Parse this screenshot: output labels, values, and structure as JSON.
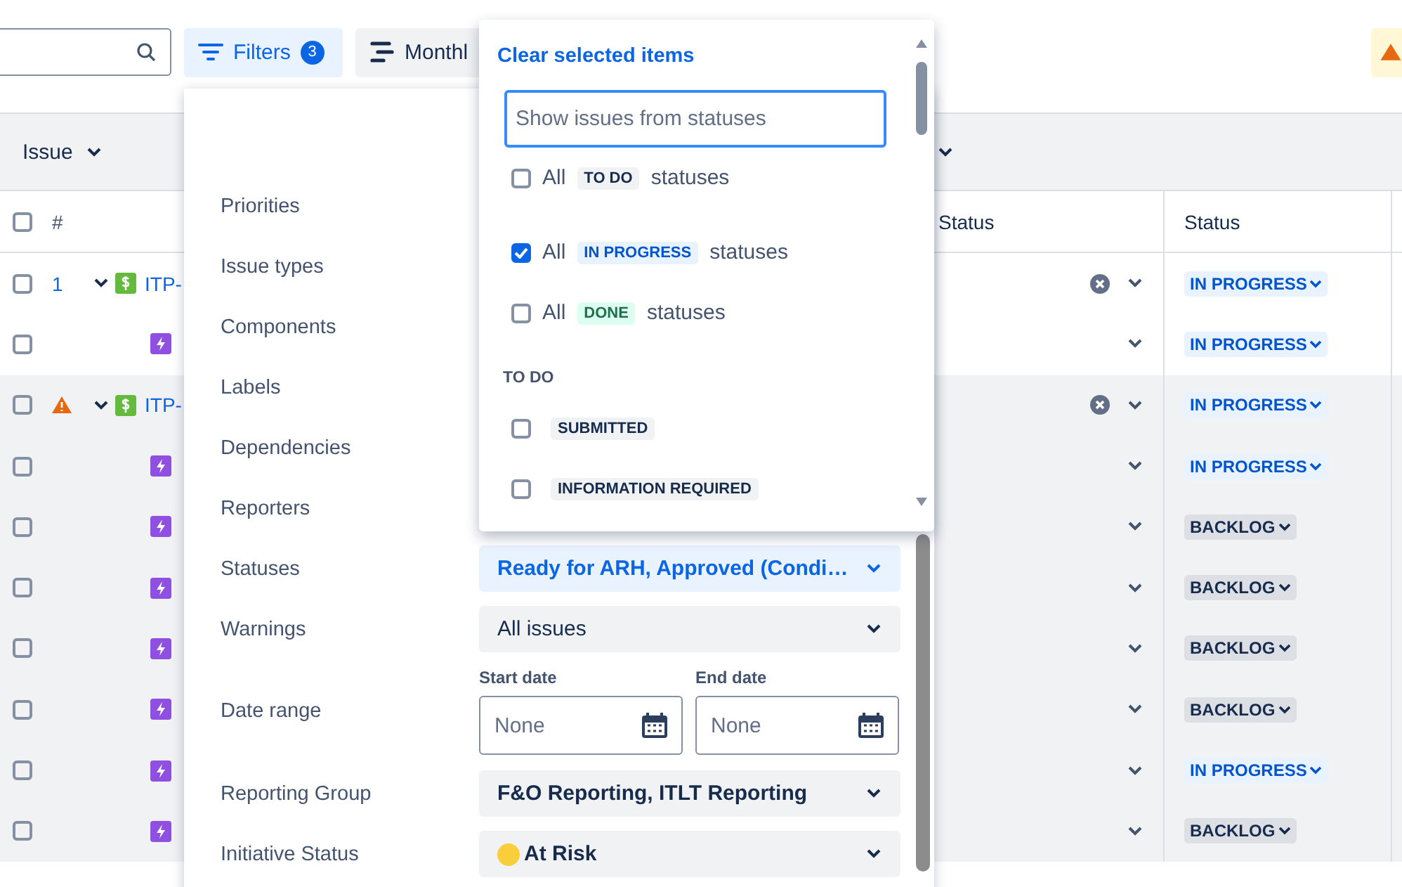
{
  "toolbar": {
    "filters": {
      "label": "Filters",
      "count": "3",
      "active": true
    },
    "view": {
      "label": "Monthl"
    }
  },
  "table": {
    "group_header": {
      "label": "Issue"
    },
    "select_all": {
      "checked": false
    },
    "columns": [
      {
        "label": "#"
      },
      {
        "label": "Status"
      },
      {
        "label": "Status"
      }
    ],
    "rows": [
      {
        "checked": false,
        "number": "1",
        "expanded": true,
        "key": "ITP-",
        "clearable": true,
        "status": {
          "label": "IN PROGRESS",
          "kind": "progress"
        },
        "highlighted": false,
        "children": [
          {
            "checked": false,
            "status": {
              "label": "IN PROGRESS",
              "kind": "progress"
            }
          }
        ]
      },
      {
        "checked": false,
        "warning": true,
        "expanded": true,
        "key": "ITP-",
        "clearable": true,
        "status": {
          "label": "IN PROGRESS",
          "kind": "progress"
        },
        "highlighted": true,
        "children": [
          {
            "checked": false,
            "status": {
              "label": "IN PROGRESS",
              "kind": "progress"
            }
          },
          {
            "checked": false,
            "status": {
              "label": "BACKLOG",
              "kind": "todo"
            }
          },
          {
            "checked": false,
            "status": {
              "label": "BACKLOG",
              "kind": "todo"
            }
          },
          {
            "checked": false,
            "status": {
              "label": "BACKLOG",
              "kind": "todo"
            }
          },
          {
            "checked": false,
            "status": {
              "label": "BACKLOG",
              "kind": "todo"
            }
          },
          {
            "checked": false,
            "status": {
              "label": "IN PROGRESS",
              "kind": "progress"
            }
          },
          {
            "checked": false,
            "status": {
              "label": "BACKLOG",
              "kind": "todo"
            }
          }
        ]
      }
    ]
  },
  "filter_panel": {
    "fields": [
      {
        "label": "Priorities"
      },
      {
        "label": "Issue types"
      },
      {
        "label": "Components"
      },
      {
        "label": "Labels"
      },
      {
        "label": "Dependencies"
      },
      {
        "label": "Reporters"
      },
      {
        "label": "Statuses",
        "control": {
          "kind": "select",
          "value": "Ready for ARH, Approved (Condi…",
          "selected": true,
          "filled": true
        }
      },
      {
        "label": "Warnings",
        "control": {
          "kind": "select",
          "value": "All issues",
          "selected": false,
          "filled": false
        }
      },
      {
        "label": "Date range",
        "control": {
          "kind": "dates",
          "start": {
            "label": "Start date",
            "placeholder": "None"
          },
          "end": {
            "label": "End date",
            "placeholder": "None"
          }
        }
      },
      {
        "label": "Reporting Group",
        "control": {
          "kind": "select",
          "value": "F&O Reporting, ITLT Reporting",
          "selected": false,
          "filled": true
        }
      },
      {
        "label": "Initiative Status",
        "control": {
          "kind": "select",
          "value": "At Risk",
          "selected": false,
          "filled": true,
          "color": "#f8cf3a"
        }
      }
    ]
  },
  "status_dropdown": {
    "link": "Clear selected items",
    "search": {
      "placeholder": "Show issues from statuses"
    },
    "category_options": [
      {
        "prefix": "All",
        "status": {
          "label": "TO DO",
          "kind": "todo"
        },
        "suffix": "statuses",
        "checked": false
      },
      {
        "prefix": "All",
        "status": {
          "label": "IN PROGRESS",
          "kind": "progress"
        },
        "suffix": "statuses",
        "checked": true
      },
      {
        "prefix": "All",
        "status": {
          "label": "DONE",
          "kind": "done"
        },
        "suffix": "statuses",
        "checked": false
      }
    ],
    "sections": [
      {
        "title": "TO DO",
        "options": [
          {
            "status": {
              "label": "SUBMITTED",
              "kind": "todo"
            },
            "checked": false
          },
          {
            "status": {
              "label": "INFORMATION REQUIRED",
              "kind": "todo"
            },
            "checked": false
          }
        ]
      }
    ]
  }
}
